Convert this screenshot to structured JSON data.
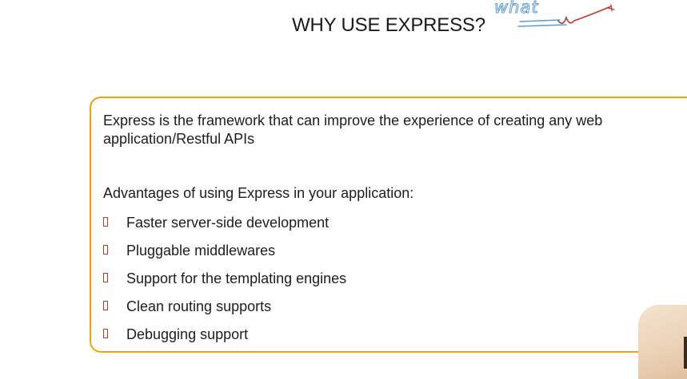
{
  "slide": {
    "title": "WHY USE EXPRESS?",
    "intro": "Express is the framework that can improve the experience of creating any web application/Restful APIs",
    "advantages_heading": "Advantages of using Express in your application:",
    "advantages": [
      "Faster server-side development",
      "Pluggable middlewares",
      "Support for the templating engines",
      "Clean routing supports",
      "Debugging support"
    ]
  },
  "annotation": {
    "handwritten_text": "what",
    "colors": {
      "blue_ink": "#5b9bd5",
      "red_ink": "#c0392b"
    }
  },
  "theme": {
    "box_border_color": "#e8a800",
    "bullet_color": "#c0392b"
  }
}
